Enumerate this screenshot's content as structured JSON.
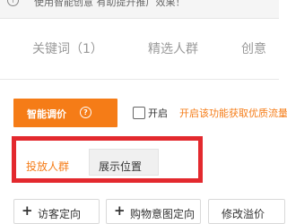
{
  "notice": {
    "icon": "info-circle-icon",
    "text": "使用智能创意 有助提升推广效果！"
  },
  "tabs": [
    {
      "label": "关键词（1）",
      "active": false
    },
    {
      "label": "精选人群",
      "active": false
    },
    {
      "label": "创意",
      "active": false
    }
  ],
  "smart_bid": {
    "label": "智能调价",
    "help_icon": "question-circle-icon",
    "toggle_label": "开启",
    "toggle_checked": false,
    "hint": "开启该功能获取优质流量"
  },
  "sub_tabs": [
    {
      "label": "投放人群",
      "active": true
    },
    {
      "label": "展示位置",
      "active": false
    }
  ],
  "actions": [
    {
      "label": "访客定向",
      "icon": "plus-icon"
    },
    {
      "label": "购物意图定向",
      "icon": "plus-icon"
    },
    {
      "label": "修改溢价"
    }
  ],
  "colors": {
    "accent": "#f57c17",
    "highlight": "#e3292e"
  }
}
